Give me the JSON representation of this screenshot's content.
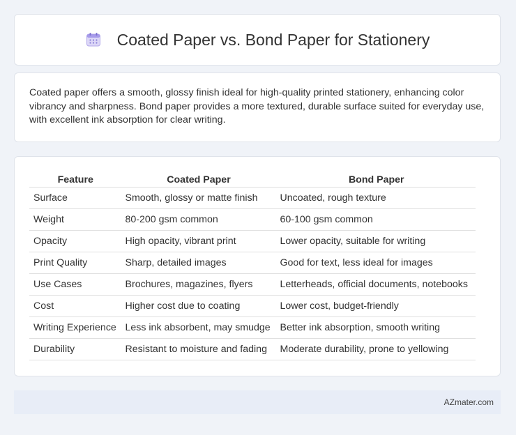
{
  "header": {
    "icon": "calendar-icon",
    "title": "Coated Paper vs. Bond Paper for Stationery"
  },
  "intro": {
    "text": "Coated paper offers a smooth, glossy finish ideal for high-quality printed stationery, enhancing color vibrancy and sharpness. Bond paper provides a more textured, durable surface suited for everyday use, with excellent ink absorption for clear writing."
  },
  "table": {
    "headers": [
      "Feature",
      "Coated Paper",
      "Bond Paper"
    ],
    "rows": [
      [
        "Surface",
        "Smooth, glossy or matte finish",
        "Uncoated, rough texture"
      ],
      [
        "Weight",
        "80-200 gsm common",
        "60-100 gsm common"
      ],
      [
        "Opacity",
        "High opacity, vibrant print",
        "Lower opacity, suitable for writing"
      ],
      [
        "Print Quality",
        "Sharp, detailed images",
        "Good for text, less ideal for images"
      ],
      [
        "Use Cases",
        "Brochures, magazines, flyers",
        "Letterheads, official documents, notebooks"
      ],
      [
        "Cost",
        "Higher cost due to coating",
        "Lower cost, budget-friendly"
      ],
      [
        "Writing Experience",
        "Less ink absorbent, may smudge",
        "Better ink absorption, smooth writing"
      ],
      [
        "Durability",
        "Resistant to moisture and fading",
        "Moderate durability, prone to yellowing"
      ]
    ]
  },
  "footer": {
    "brand": "AZmater.com"
  },
  "colors": {
    "page_background": "#f0f3f8",
    "card_background": "#ffffff",
    "footer_background": "#e8edf7",
    "text": "#333333",
    "icon_accent": "#8a7fd8"
  }
}
